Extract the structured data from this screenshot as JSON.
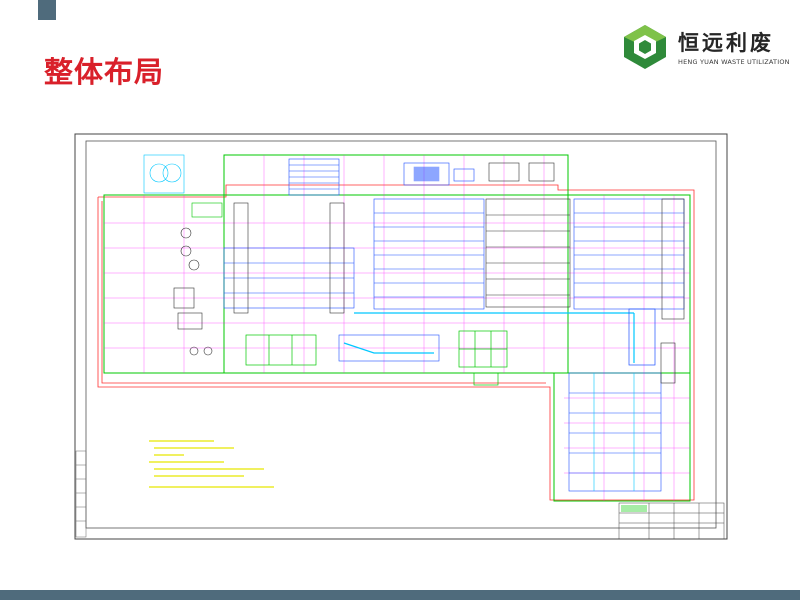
{
  "slide": {
    "title": "整体布局"
  },
  "logo": {
    "name": "恒远利废",
    "subtitle": "HENG YUAN WASTE UTILIZATION",
    "colors": {
      "dark_green": "#2f8a3a",
      "light_green": "#7fc249"
    }
  },
  "drawing": {
    "description_icon": "cad-floor-plan",
    "colors": {
      "line_green": "#00c800",
      "line_magenta": "#ff00ff",
      "line_blue": "#1e50ff",
      "line_red": "#ff3030",
      "line_cyan": "#00c8ff",
      "note_yellow": "#e8e800"
    }
  },
  "theme": {
    "accent_bar": "#4f6b7c",
    "title_red": "#d9202a"
  }
}
